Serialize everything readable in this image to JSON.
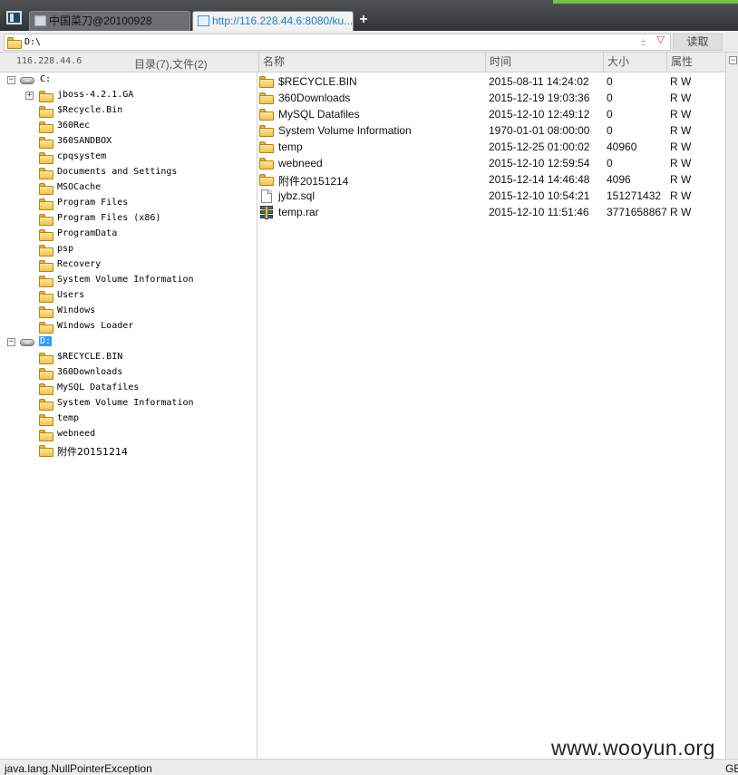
{
  "tabs": [
    {
      "label": "中国菜刀@20100928",
      "active": false
    },
    {
      "label": "http://116.228.44.6:8080/ku...",
      "active": true
    }
  ],
  "new_tab_label": "+",
  "address": {
    "path": "D:\\",
    "plusminus": "±",
    "dropdown": "▽",
    "read_button": "读取"
  },
  "info": {
    "server_ip": "116.228.44.6",
    "dir_stats": "目录(7),文件(2)"
  },
  "columns": {
    "name": "名称",
    "time": "时间",
    "size": "大小",
    "attr": "属性"
  },
  "tree": {
    "drive_c": {
      "label": "C:",
      "toggle": "−",
      "children": [
        {
          "label": "jboss-4.2.1.GA",
          "toggle": "+"
        },
        {
          "label": "$Recycle.Bin"
        },
        {
          "label": "360Rec"
        },
        {
          "label": "360SANDBOX"
        },
        {
          "label": "cpqsystem"
        },
        {
          "label": "Documents and Settings"
        },
        {
          "label": "MSOCache"
        },
        {
          "label": "Program Files"
        },
        {
          "label": "Program Files (x86)"
        },
        {
          "label": "ProgramData"
        },
        {
          "label": "psp"
        },
        {
          "label": "Recovery"
        },
        {
          "label": "System Volume Information"
        },
        {
          "label": "Users"
        },
        {
          "label": "Windows"
        },
        {
          "label": "Windows Loader"
        }
      ]
    },
    "drive_d": {
      "label": "D:",
      "toggle": "−",
      "selected": true,
      "children": [
        {
          "label": "$RECYCLE.BIN"
        },
        {
          "label": "360Downloads"
        },
        {
          "label": "MySQL Datafiles"
        },
        {
          "label": "System Volume Information"
        },
        {
          "label": "temp"
        },
        {
          "label": "webneed"
        },
        {
          "label": "附件20151214"
        }
      ]
    }
  },
  "files": [
    {
      "name": "$RECYCLE.BIN",
      "time": "2015-08-11 14:24:02",
      "size": "0",
      "attr": "R W",
      "icon": "folder-icon"
    },
    {
      "name": "360Downloads",
      "time": "2015-12-19 19:03:36",
      "size": "0",
      "attr": "R W",
      "icon": "folder-icon"
    },
    {
      "name": "MySQL Datafiles",
      "time": "2015-12-10 12:49:12",
      "size": "0",
      "attr": "R W",
      "icon": "folder-icon"
    },
    {
      "name": "System Volume Information",
      "time": "1970-01-01 08:00:00",
      "size": "0",
      "attr": "R W",
      "icon": "folder-icon"
    },
    {
      "name": "temp",
      "time": "2015-12-25 01:00:02",
      "size": "40960",
      "attr": "R W",
      "icon": "folder-icon"
    },
    {
      "name": "webneed",
      "time": "2015-12-10 12:59:54",
      "size": "0",
      "attr": "R W",
      "icon": "folder-icon"
    },
    {
      "name": "附件20151214",
      "time": "2015-12-14 14:46:48",
      "size": "4096",
      "attr": "R W",
      "icon": "folder-icon"
    },
    {
      "name": "jybz.sql",
      "time": "2015-12-10 10:54:21",
      "size": "151271432",
      "attr": "R W",
      "icon": "document-icon"
    },
    {
      "name": "temp.rar",
      "time": "2015-12-10 11:51:46",
      "size": "3771658867",
      "attr": "R W",
      "icon": "rar-archive-icon"
    }
  ],
  "status": {
    "message": "java.lang.NullPointerException",
    "encoding": "GE"
  },
  "watermark": "www.wooyun.org",
  "colors": {
    "tab_active_text": "#1d7ec5",
    "selection": "#3399ff",
    "folder": "#f1c34d",
    "accent_green": "#76c043"
  }
}
